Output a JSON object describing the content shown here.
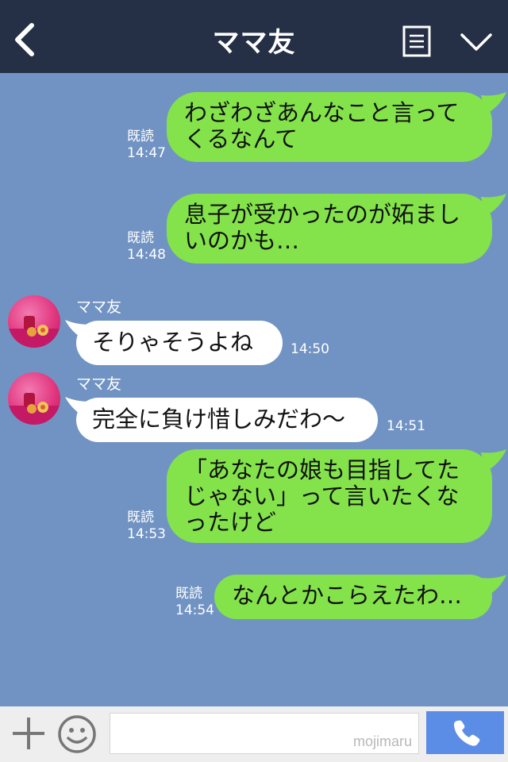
{
  "header": {
    "title": "ママ友",
    "back_icon": "chevron-left-icon",
    "menu_icon": "menu-icon",
    "collapse_icon": "chevron-down-icon",
    "bg_color": "#252f45"
  },
  "chat": {
    "bg_color": "#7193c3",
    "sent_bubble_color": "#84e34b",
    "received_bubble_color": "#ffffff",
    "messages": [
      {
        "type": "sent",
        "text": "わざわざあんなこと言って\nくるなんて",
        "read": "既読",
        "time": "14:47"
      },
      {
        "type": "sent",
        "text": "息子が受かったのが妬まし\nいのかも…",
        "read": "既読",
        "time": "14:48"
      },
      {
        "type": "received",
        "name": "ママ友",
        "text": "そりゃそうよね",
        "time": "14:50"
      },
      {
        "type": "received",
        "name": "ママ友",
        "text": "完全に負け惜しみだわ〜",
        "time": "14:51"
      },
      {
        "type": "sent",
        "text": "「あなたの娘も目指してた\nじゃない」って言いたくな\nったけど",
        "read": "既読",
        "time": "14:53"
      },
      {
        "type": "sent",
        "text": "なんとかこらえたわ…",
        "read": "既読",
        "time": "14:54"
      }
    ]
  },
  "footer": {
    "plus_icon": "plus-icon",
    "emoji_icon": "smiley-icon",
    "input_value": "",
    "watermark": "mojimaru",
    "call_icon": "phone-icon",
    "call_color": "#5b8de6"
  }
}
